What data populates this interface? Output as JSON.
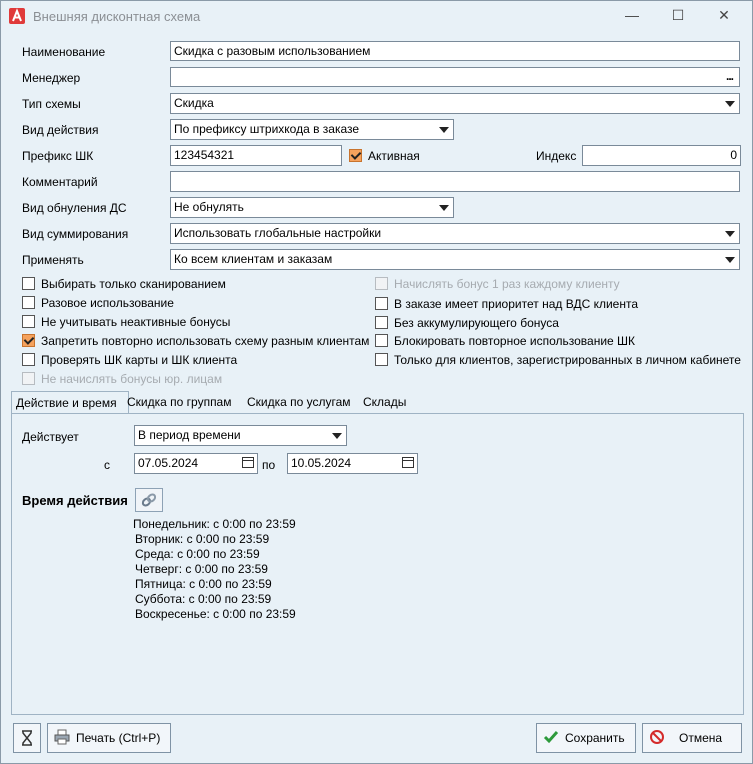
{
  "window": {
    "title": "Внешняя дисконтная схема",
    "minimize_icon": "minimize-icon",
    "maximize_icon": "maximize-icon",
    "close_icon": "close-icon"
  },
  "form": {
    "name_label": "Наименование",
    "name_value": "Скидка с разовым использованием",
    "manager_label": "Менеджер",
    "manager_value": "",
    "manager_button": "...",
    "scheme_type_label": "Тип схемы",
    "scheme_type_value": "Скидка",
    "action_type_label": "Вид действия",
    "action_type_value": "По префиксу штрихкода в заказе",
    "prefix_label": "Префикс ШК",
    "prefix_value": "123454321",
    "active_label": "Активная",
    "index_label": "Индекс",
    "index_value": "0",
    "comment_label": "Комментарий",
    "comment_value": "",
    "reset_type_label": "Вид обнуления ДС",
    "reset_type_value": "Не обнулять",
    "sum_type_label": "Вид суммирования",
    "sum_type_value": "Использовать глобальные настройки",
    "apply_label": "Применять",
    "apply_value": "Ко всем клиентам и заказам"
  },
  "checkboxes_left": [
    {
      "label": "Выбирать только сканированием",
      "checked": false,
      "disabled": false
    },
    {
      "label": "Разовое использование",
      "checked": false,
      "disabled": false
    },
    {
      "label": "Не учитывать неактивные бонусы",
      "checked": false,
      "disabled": false
    },
    {
      "label": "Запретить повторно использовать схему разным клиентам",
      "checked": true,
      "disabled": false
    },
    {
      "label": "Проверять ШК карты и ШК клиента",
      "checked": false,
      "disabled": false
    },
    {
      "label": "Не начислять бонусы юр. лицам",
      "checked": false,
      "disabled": true
    }
  ],
  "checkboxes_right": [
    {
      "label": "Начислять бонус 1 раз каждому клиенту",
      "checked": false,
      "disabled": true
    },
    {
      "label": "В заказе имеет приоритет над ВДС клиента",
      "checked": false,
      "disabled": false
    },
    {
      "label": "Без аккумулирующего бонуса",
      "checked": false,
      "disabled": false
    },
    {
      "label": "Блокировать повторное использование ШК",
      "checked": false,
      "disabled": false
    },
    {
      "label": "Только для клиентов, зарегистрированных в личном кабинете",
      "checked": false,
      "disabled": false
    }
  ],
  "tabs": [
    "Действие и время",
    "Скидка по группам",
    "Скидка по услугам",
    "Склады"
  ],
  "action_time": {
    "acts_label": "Действует",
    "acts_value": "В период времени",
    "from_label": "с",
    "from_date": "07.05.2024",
    "to_label": "по",
    "to_date": "10.05.2024",
    "time_heading": "Время действия",
    "schedule": [
      "Понедельник: с 0:00 по 23:59",
      "Вторник: с 0:00 по 23:59",
      "Среда: с 0:00 по 23:59",
      "Четверг: с 0:00 по 23:59",
      "Пятница: с 0:00 по 23:59",
      "Суббота: с 0:00 по 23:59",
      "Воскресенье: с 0:00 по 23:59"
    ]
  },
  "footer": {
    "print_label": "Печать (Ctrl+P)",
    "save_label": "Сохранить",
    "cancel_label": "Отмена"
  }
}
